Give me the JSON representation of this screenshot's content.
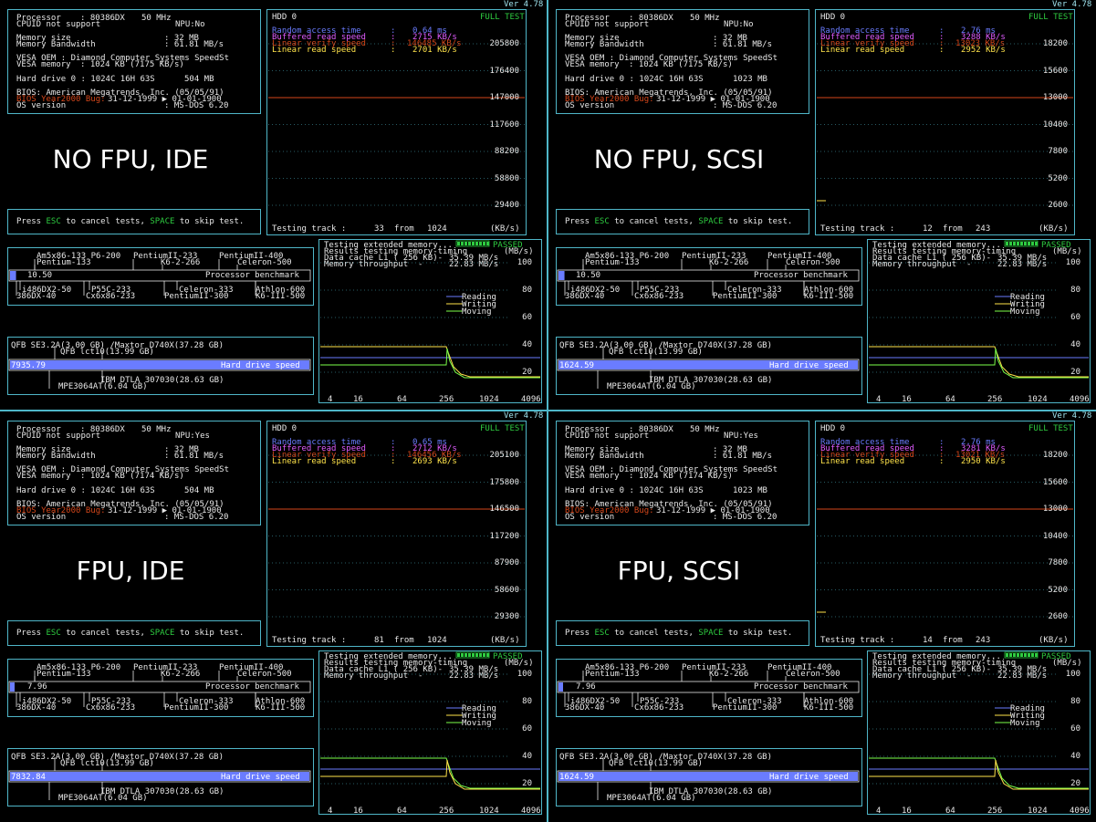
{
  "version": "Ver 4.78",
  "labels": {
    "processor": "Processor",
    "cpuid": "CPUID not support",
    "memory_size": "Memory size",
    "memory_bandwidth": "Memory Bandwidth",
    "vesa_oem": "VESA OEM : Diamond Computer Systems SpeedSt",
    "vesa_memory": "VESA memory",
    "hard_drive": "Hard drive 0 : 1024C 16H 63S",
    "bios": "BIOS: American Megatrends, Inc. (05/05/91)",
    "bios_date_prefix": "BIOS Year2000 Bug:",
    "bios_date": "31-12-1999 ▶ 01-01-1900",
    "os_version": "OS version",
    "os": ": MS-DOS 6.20",
    "memsize_val": ": 32 MB",
    "bandwidth_val": ": 61.81 MB/s",
    "press": "Press",
    "esc": "ESC",
    "to_cancel": "to cancel tests,",
    "space": "SPACE",
    "to_skip": "to skip test.",
    "hdd": "HDD 0",
    "full_test": "FULL TEST",
    "random_access": "Random access time",
    "buffered_read": "Buffered read speed",
    "linear_verify": "Linear verify speed",
    "linear_read": "Linear read speed",
    "testing_track": "Testing track :",
    "from": "from",
    "kbs": "(KB/s)",
    "mbs": "(MB/s)",
    "ext_mem": "Testing extended memory...",
    "passed": "PASSED",
    "results_mem": "Results testing memory-timing",
    "data_cache": "Data cache L1 ( 256 KB)-",
    "mem_throughput": "Memory throughput  -",
    "reading": "Reading",
    "writing": "Writing",
    "moving": "Moving",
    "proc_bench": "Processor benchmark",
    "hd_speed": "Hard drive speed",
    "cpu_top1": "Am5x86-133 P6-200",
    "cpu_top2": "PentiumII-233",
    "cpu_top3": "PentiumII-400",
    "cpu_top4": "Pentium-133",
    "cpu_top5": "K6-2-266",
    "cpu_top6": "Celeron-500",
    "cpu_bot1": "i486DX2-50",
    "cpu_bot2": "P55C-233",
    "cpu_bot3": "Celeron-333",
    "cpu_bot4": "Athlon-600",
    "cpu_bot5": "386DX-40",
    "cpu_bot6": "Cx6x86-233",
    "cpu_bot7": "PentiumII-300",
    "cpu_bot8": "K6-III-500",
    "hd_top1": "QFB SE3.2A(3.00 GB) /Maxtor D740X(37.28 GB)",
    "hd_top2": "QFB lct10(13.99 GB)",
    "hd_bot1": "IBM DTLA 307030(28.63 GB)",
    "hd_bot2": "MPE3064AT(6.04 GB)",
    "mem_xticks": [
      "4",
      "16",
      "64",
      "256",
      "1024",
      "4096"
    ],
    "mem_yticks": [
      "100",
      "80",
      "60",
      "40",
      "20"
    ],
    "data_cache_val": "35.39 MB/s",
    "mem_throughput_val": "22.83 MB/s"
  },
  "panels": [
    {
      "overlay": "NO FPU, IDE",
      "cpu_name": ": 80386DX",
      "cpu_mhz": "50 MHz",
      "npu": "NPU:No",
      "vesa_memory_val": ": 1024 KB (7175 KB/s)",
      "hd_size": "504 MB",
      "random_access_val": "0.64 ms",
      "buffered_val": "2715 KB/s",
      "linear_verify_val": "146485 KB/s",
      "linear_read_val": "2701 KB/s",
      "yticks": [
        "205800",
        "176400",
        "147000",
        "117600",
        "88200",
        "58800",
        "29400"
      ],
      "track": "33",
      "track_total": "1024",
      "proc_score": "10.50",
      "proc_fill": 0.02,
      "hd_score": "7935.79",
      "hd_fill": 1.0,
      "hdd_line": 0.714,
      "hdd_ystep": 29400
    },
    {
      "overlay": "NO FPU, SCSI",
      "cpu_name": ": 80386DX",
      "cpu_mhz": "50 MHz",
      "npu": "NPU:No",
      "vesa_memory_val": ": 1024 KB (7175 KB/s)",
      "hd_size": "1023 MB",
      "random_access_val": "2.76 ms",
      "buffered_val": "3288 KB/s",
      "linear_verify_val": "13023 KB/s",
      "linear_read_val": "2952 KB/s",
      "yticks": [
        "18200",
        "15600",
        "13000",
        "10400",
        "7800",
        "5200",
        "2600"
      ],
      "track": "12",
      "track_total": "243",
      "proc_score": "10.50",
      "proc_fill": 0.02,
      "hd_score": "1624.59",
      "hd_fill": 1.0,
      "hdd_line": 0.714,
      "hdd_ystep": 2600
    },
    {
      "overlay": "FPU, IDE",
      "cpu_name": ": 80386DX",
      "cpu_mhz": "50 MHz",
      "npu": "NPU:Yes",
      "vesa_memory_val": ": 1024 KB (7174 KB/s)",
      "hd_size": "504 MB",
      "random_access_val": "0.65 ms",
      "buffered_val": "2712 KB/s",
      "linear_verify_val": "146456 KB/s",
      "linear_read_val": "2693 KB/s",
      "yticks": [
        "205100",
        "175800",
        "146500",
        "117200",
        "87900",
        "58600",
        "29300"
      ],
      "track": "81",
      "track_total": "1024",
      "proc_score": "7.96",
      "proc_fill": 0.0,
      "hd_score": "7832.84",
      "hd_fill": 1.0,
      "hdd_line": 0.714,
      "hdd_ystep": 29300
    },
    {
      "overlay": "FPU, SCSI",
      "cpu_name": ": 80386DX",
      "cpu_mhz": "50 MHz",
      "npu": "NPU:Yes",
      "vesa_memory_val": ": 1024 KB (7174 KB/s)",
      "hd_size": "1023 MB",
      "random_access_val": "2.76 ms",
      "buffered_val": "3281 KB/s",
      "linear_verify_val": "13021 KB/s",
      "linear_read_val": "2950 KB/s",
      "yticks": [
        "18200",
        "15600",
        "13000",
        "10400",
        "7800",
        "5200",
        "2600"
      ],
      "track": "14",
      "track_total": "243",
      "proc_score": "7.96",
      "proc_fill": 0.0,
      "hd_score": "1624.59",
      "hd_fill": 1.0,
      "hdd_line": 0.714,
      "hdd_ystep": 2600
    }
  ],
  "colors": {
    "border": "#4fb6c8",
    "random": "#6a7cff",
    "buffered": "#e05cff",
    "verify": "#d4461a",
    "linear": "#ffe34a",
    "passed": "#2ecc40",
    "bar": "#6a7cff",
    "reading": "#ffe34a",
    "writing": "#6a7cff",
    "moving": "#7cff4a"
  }
}
